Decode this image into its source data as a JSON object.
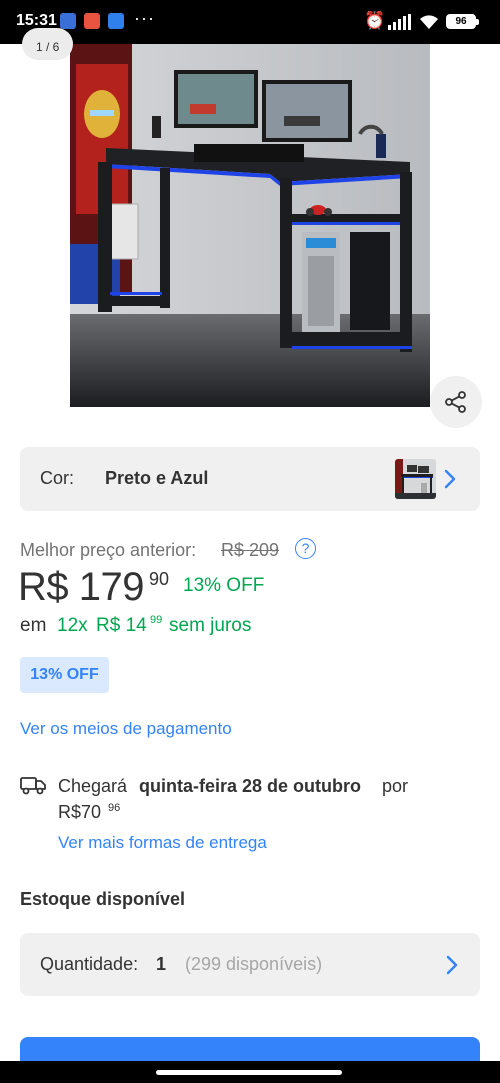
{
  "status_bar": {
    "time": "15:31",
    "more_indicator": "···",
    "battery": "96",
    "icons": [
      "messages-app-icon",
      "gallery-app-icon",
      "phone-app-icon",
      "alarm-icon",
      "signal-icon",
      "wifi-icon",
      "battery-icon"
    ]
  },
  "gallery": {
    "counter": "1 / 6",
    "image_subject": "black gaming desk with blue LED trim, two monitors, keyboard and PC tower"
  },
  "share": {
    "icon": "share-icon"
  },
  "color_option": {
    "label": "Cor:",
    "value": "Preto e Azul",
    "icon": "chevron-right-icon"
  },
  "price": {
    "previous_label": "Melhor preço anterior:",
    "previous_value": "R$ 209",
    "current_main": "R$ 179",
    "current_cents": "90",
    "discount": "13% OFF",
    "installment_prefix": "em",
    "installment_count": "12x",
    "installment_amount": "R$ 14",
    "installment_cents": "99",
    "installment_suffix": "sem juros",
    "badge": "13% OFF",
    "payment_link": "Ver os meios de pagamento"
  },
  "delivery": {
    "prefix": "Chegará",
    "date": "quinta-feira 28 de outubro",
    "connector": "por",
    "price": "R$70",
    "price_cents": "96",
    "more_link": "Ver mais formas de entrega",
    "icon": "truck-icon"
  },
  "stock": {
    "title": "Estoque disponível",
    "quantity_label": "Quantidade:",
    "quantity_value": "1",
    "available": "(299 disponíveis)"
  },
  "colors": {
    "accent": "#3483fa",
    "green": "#00a650",
    "badge_bg": "#dae9fd",
    "row_bg": "#f0f0f0"
  }
}
